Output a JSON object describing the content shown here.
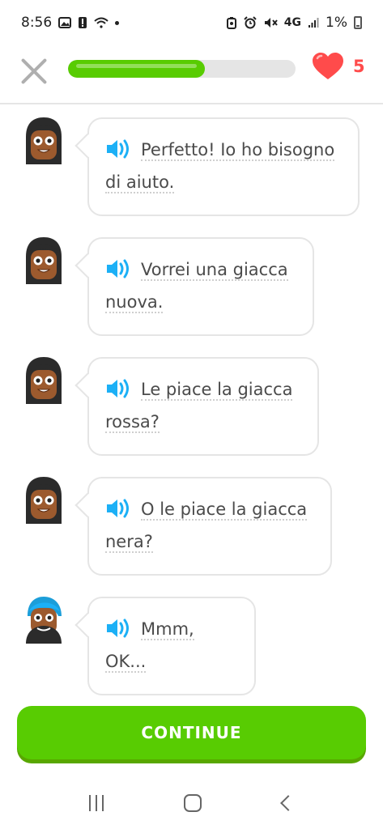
{
  "status_bar": {
    "time": "8:56",
    "network": "4G",
    "battery": "1%"
  },
  "lesson": {
    "progress_percent": 60,
    "hearts": "5",
    "colors": {
      "accent": "#58cc02",
      "heart": "#ff4b4b",
      "speaker": "#1cb0f6"
    }
  },
  "messages": [
    {
      "speaker_character": "woman",
      "text": "Perfetto! Io ho bisogno di aiuto."
    },
    {
      "speaker_character": "woman",
      "text": "Vorrei una giacca nuova."
    },
    {
      "speaker_character": "woman",
      "text": "Le piace la giacca rossa?"
    },
    {
      "speaker_character": "woman",
      "text": "O le piace la giacca nera?"
    },
    {
      "speaker_character": "man",
      "text": "Mmm, OK..."
    }
  ],
  "continue_label": "CONTINUE"
}
